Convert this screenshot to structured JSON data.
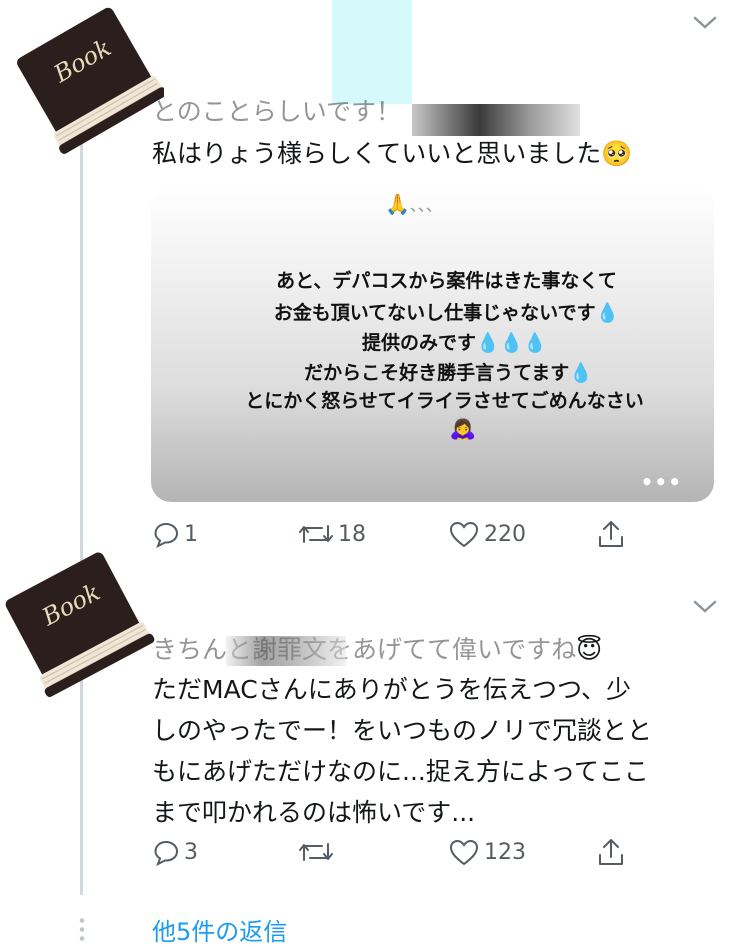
{
  "tweet1": {
    "text_top": "とのことらしいです！",
    "text_main": "私はりょう様らしくていいと思いました",
    "text_main_emoji": "🥺",
    "media": {
      "top_emoji": "🙏",
      "top_ellipsis": "、、、",
      "lines": [
        "あと、デパコスから案件はきた事なくて",
        "お金も頂いてないし仕事じゃないです💧",
        "提供のみです💧💧💧",
        "だからこそ好き勝手言うてます💧",
        "とにかく怒らせてイライラさせてごめんなさい"
      ],
      "bottom_emoji": "🙇‍♀️",
      "more": "•••"
    },
    "reply_count": "1",
    "retweet_count": "18",
    "like_count": "220"
  },
  "tweet2": {
    "text_top": "きちんと謝罪文をあげてて偉いですね",
    "text_top_emoji": "😇",
    "lines": [
      "ただMACさんにありがとうを伝えつつ、少",
      "しのやったでー！をいつものノリで冗談とと",
      "もにあげただけなのに...捉え方によってここ",
      "まで叩かれるのは怖いです..."
    ],
    "reply_count": "3",
    "retweet_count": "",
    "like_count": "123"
  },
  "more_replies": "他5件の返信",
  "icons": {
    "avatar": "book-icon",
    "reply": "speech-bubble-icon",
    "retweet": "retweet-icon",
    "like": "heart-icon",
    "share": "share-icon",
    "menu": "chevron-down-icon"
  },
  "colors": {
    "link": "#1d9bf0",
    "text": "#14171a",
    "muted": "#555c63",
    "book": "#2a1f1c"
  }
}
